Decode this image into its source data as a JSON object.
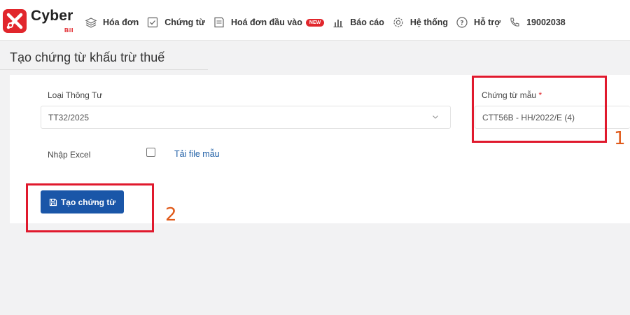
{
  "brand": {
    "name": "Cyber",
    "sub": "Bill"
  },
  "nav": {
    "items": [
      {
        "label": "Hóa đơn",
        "icon": "layers-icon"
      },
      {
        "label": "Chứng từ",
        "icon": "checklist-icon"
      },
      {
        "label": "Hoá đơn đầu vào",
        "icon": "inbox-icon",
        "badge": "NEW"
      },
      {
        "label": "Báo cáo",
        "icon": "bar-chart-icon"
      },
      {
        "label": "Hệ thống",
        "icon": "gear-icon"
      },
      {
        "label": "Hỗ trợ",
        "icon": "help-icon"
      }
    ],
    "hotline": "19002038",
    "hotline_icon": "phone-icon"
  },
  "page": {
    "title": "Tạo chứng từ khấu trừ thuế"
  },
  "form": {
    "circular_label": "Loại Thông Tư",
    "circular_value": "TT32/2025",
    "template_label": "Chứng từ mẫu",
    "template_required_mark": "*",
    "template_value": "CTT56B - HH/2022/E (4)",
    "import_excel_label": "Nhập Excel",
    "import_excel_checked": false,
    "download_template_link": "Tải file mẫu",
    "create_button_label": "Tạo chứng từ"
  },
  "annotations": {
    "step_1": "1",
    "step_2": "2"
  },
  "colors": {
    "brand_red": "#e1262c",
    "primary_blue": "#1a56a8",
    "link_blue": "#1f5fa6",
    "highlight_red": "#e0192d",
    "annotation_orange": "#e05a1a"
  }
}
